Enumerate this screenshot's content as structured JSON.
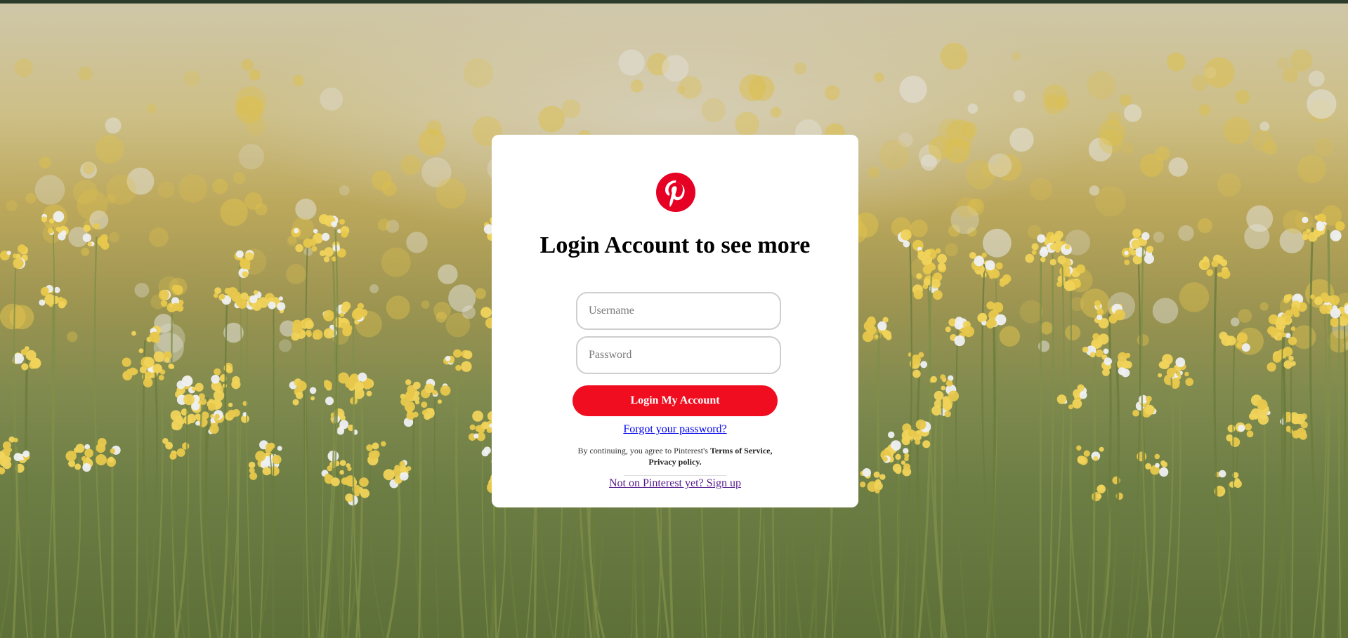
{
  "page": {
    "background_description_colors": {
      "flowers_yellow": "#e3c24a",
      "stems_green": "#5d7038",
      "top_bar": "#2c3b2c"
    }
  },
  "brand": {
    "logo_icon": "pinterest-logo-icon",
    "color": "#e60023"
  },
  "login": {
    "title": "Login Account to see more",
    "username_placeholder": "Username",
    "password_placeholder": "Password",
    "submit_label": "Login My Account",
    "forgot_label": "Forgot your password?",
    "terms_prefix": "By continuing, you agree to Pinterest's ",
    "terms_link": "Terms of Service,",
    "privacy_link": "Privacy policy.",
    "signup_label": "Not on Pinterest yet? Sign up",
    "button_color": "#ef0d1f"
  }
}
